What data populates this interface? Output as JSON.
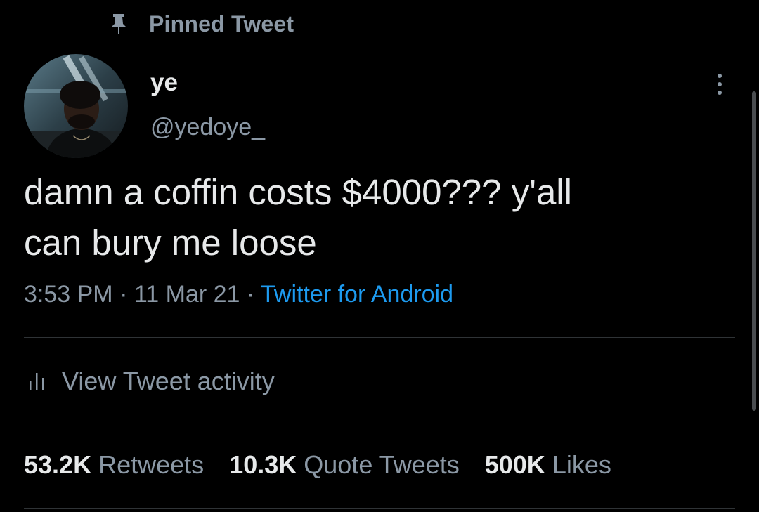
{
  "pinned": {
    "icon": "pin-icon",
    "label": "Pinned Tweet"
  },
  "author": {
    "display_name": "ye",
    "handle": "@yedoye_"
  },
  "more_icon": "more-vertical-icon",
  "tweet": {
    "text": "damn a coffin costs $4000??? y'all\ncan bury me loose",
    "time": "3:53 PM",
    "separator": " · ",
    "date": "11 Mar 21",
    "source": "Twitter for Android"
  },
  "activity": {
    "icon": "bar-chart-icon",
    "label": "View Tweet activity"
  },
  "stats": [
    {
      "count": "53.2K",
      "label": "Retweets"
    },
    {
      "count": "10.3K",
      "label": "Quote Tweets"
    },
    {
      "count": "500K",
      "label": "Likes"
    }
  ],
  "colors": {
    "background": "#000000",
    "primary_text": "#e7e9ea",
    "secondary_text": "#8b98a5",
    "link": "#1d9bf0",
    "divider": "#2f3336"
  }
}
